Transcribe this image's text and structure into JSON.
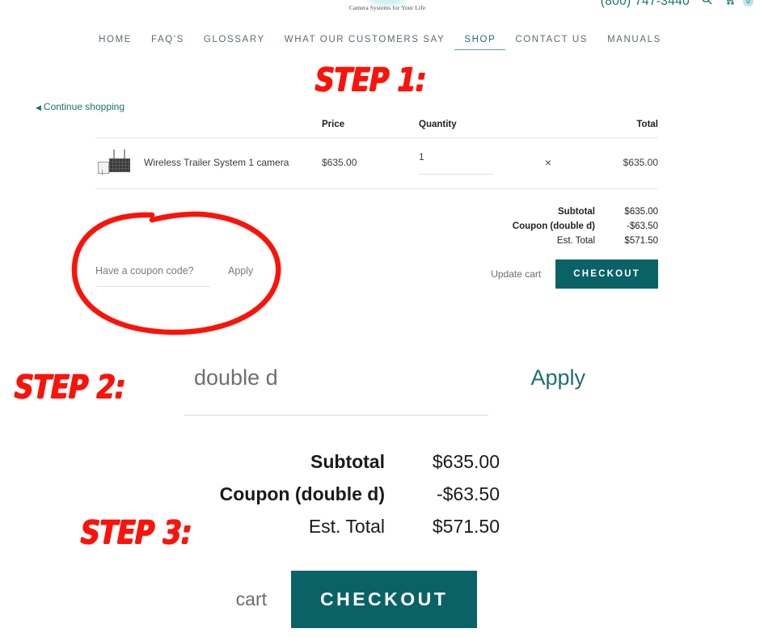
{
  "header": {
    "logo_tagline": "Camera Systems for Your Life",
    "phone": "(800) 747-3440",
    "search_icon": "search-icon",
    "cart_icon": "cart-icon",
    "cart_count": "0"
  },
  "nav": {
    "items": [
      {
        "label": "HOME",
        "active": false
      },
      {
        "label": "FAQ'S",
        "active": false
      },
      {
        "label": "GLOSSARY",
        "active": false
      },
      {
        "label": "WHAT OUR CUSTOMERS SAY",
        "active": false
      },
      {
        "label": "SHOP",
        "active": true
      },
      {
        "label": "CONTACT US",
        "active": false
      },
      {
        "label": "MANUALS",
        "active": false
      }
    ]
  },
  "annotations": {
    "step1": "STEP 1:",
    "step2": "STEP 2:",
    "step3": "STEP 3:",
    "circle_color": "#fb1309"
  },
  "cart": {
    "continue_shopping": "Continue shopping",
    "columns": {
      "price": "Price",
      "quantity": "Quantity",
      "total": "Total"
    },
    "rows": [
      {
        "thumb": "wireless-trailer-camera-thumbnail",
        "name": "Wireless Trailer System 1 camera",
        "price": "$635.00",
        "quantity": "1",
        "remove": "×",
        "total": "$635.00"
      }
    ],
    "totals": [
      {
        "label": "Subtotal",
        "value": "$635.00"
      },
      {
        "label": "Coupon (double d)",
        "value": "-$63.50"
      },
      {
        "label": "Est. Total",
        "value": "$571.50"
      }
    ],
    "coupon": {
      "placeholder": "Have a coupon code?",
      "value": "",
      "apply_label": "Apply"
    },
    "update_cart_label": "Update cart",
    "checkout_label": "CHECKOUT",
    "checkout_color": "#0b6266"
  },
  "zoom_coupon": {
    "value": "double d",
    "apply_label": "Apply"
  },
  "zoom_totals": [
    {
      "label": "Subtotal",
      "value": "$635.00"
    },
    {
      "label": "Coupon (double d)",
      "value": "-$63.50"
    },
    {
      "label": "Est. Total",
      "value": "$571.50"
    }
  ],
  "zoom_actions": {
    "update_cart_label": "cart",
    "checkout_label": "CHECKOUT"
  }
}
